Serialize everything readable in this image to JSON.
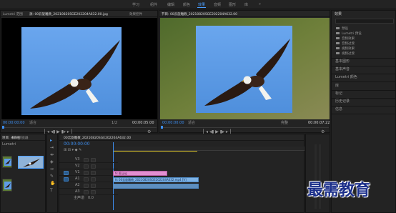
{
  "topbar": {
    "workspaces": [
      "学习",
      "组件",
      "编辑",
      "颜色",
      "效果",
      "音频",
      "图形",
      "库"
    ],
    "active_workspace": "效果"
  },
  "source_panel": {
    "tab_label": "Lumetri 范围",
    "title": "源: 00云旋雕教_20210820SGE202204A632.00.jpg",
    "effect_controls_label": "效果控件",
    "timecode": "00:00:00:00",
    "fit_label": "适合",
    "duration": "00:00:05:00",
    "fraction": "1/2"
  },
  "program_panel": {
    "title": "节目: 00云旋雕教_20210820SGE202204A632.00",
    "timecode": "00:00:00:00",
    "fit_label": "适合",
    "fraction": "完整",
    "duration": "00:00:07:22"
  },
  "project_panel": {
    "tabs": [
      "项目: 未命名",
      "媒体浏览器"
    ],
    "label": "Lumetri"
  },
  "timeline": {
    "title": "00云旋雕教_20210820SGE202204A632.00",
    "timecode": "00:00:00:00",
    "tracks": [
      "V3",
      "V2",
      "V1",
      "A1",
      "A2",
      "A3"
    ],
    "master_label": "主声道",
    "master_value": "0.0",
    "clips": {
      "v2": "fx 图.jpg",
      "v1": "fx 00云旋雕教_20210820SGE202204A632.mp4 [V]",
      "a1": ""
    }
  },
  "effects_panel": {
    "title": "效果",
    "items": [
      "预设",
      "Lumetri 预设",
      "音频效果",
      "音频过渡",
      "视频效果",
      "视频过渡"
    ],
    "sections": [
      "基本图形",
      "基本声音",
      "Lumetri 颜色",
      "库",
      "标记",
      "历史记录",
      "信息"
    ]
  },
  "watermark": "最需教育",
  "colors": {
    "accent": "#4a9eff",
    "timecode": "#3d8ef0"
  }
}
